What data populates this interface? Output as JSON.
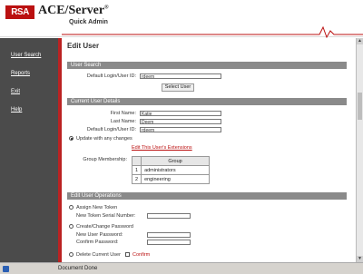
{
  "header": {
    "logo": "RSA",
    "product": "ACE/Server",
    "product_mark": "®",
    "subtitle": "Quick Admin"
  },
  "sidebar": {
    "items": [
      {
        "label": "User Search"
      },
      {
        "label": "Reports"
      },
      {
        "label": "Exit"
      },
      {
        "label": "Help"
      }
    ]
  },
  "main": {
    "title": "Edit User",
    "user_search": {
      "section": "User Search",
      "login_label": "Default Login/User ID:",
      "login_value": "rdeem",
      "select_button": "Select User"
    },
    "current_details": {
      "section": "Current User Details",
      "first_name_label": "First Name:",
      "first_name_value": "Katie",
      "last_name_label": "Last Name:",
      "last_name_value": "Deem",
      "login_label": "Default Login/User ID:",
      "login_value": "rdeem",
      "update_label": "Update with any changes",
      "extensions_link": "Edit This User's Extensions",
      "group_label": "Group Membership:",
      "group_header": "Group",
      "groups": [
        {
          "num": "1",
          "name": "administrators"
        },
        {
          "num": "2",
          "name": "engineering"
        }
      ]
    },
    "operations": {
      "section": "Edit User Operations",
      "assign_token": "Assign New Token",
      "serial_label": "New Token Serial Number:",
      "create_password": "Create/Change Password",
      "new_password_label": "New User Password:",
      "confirm_password_label": "Confirm Password:",
      "delete_user": "Delete Current User",
      "confirm": "Confirm"
    }
  },
  "status": {
    "text": "Document Done"
  },
  "colors": {
    "brand_red": "#b11",
    "sidebar": "#4b4b4b",
    "section_bar": "#8a8a8a"
  }
}
